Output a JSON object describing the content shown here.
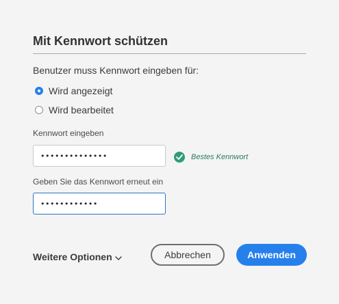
{
  "dialog": {
    "title": "Mit Kennwort schützen",
    "prompt": "Benutzer muss Kennwort eingeben für:"
  },
  "options": [
    {
      "label": "Wird angezeigt",
      "checked": true
    },
    {
      "label": "Wird bearbeitet",
      "checked": false
    }
  ],
  "password": {
    "label": "Kennwort eingeben",
    "value": "••••••••••••••",
    "strength_icon": "check-circle-icon",
    "strength_text": "Bestes Kennwort"
  },
  "confirm": {
    "label": "Geben Sie das Kennwort erneut ein",
    "value": "••••••••••••"
  },
  "footer": {
    "more_options": "Weitere Optionen",
    "more_options_icon": "chevron-down-icon",
    "cancel_label": "Abbrechen",
    "apply_label": "Anwenden"
  },
  "colors": {
    "accent": "#2680eb",
    "success": "#2d9d78",
    "background": "#f4f4f4"
  }
}
